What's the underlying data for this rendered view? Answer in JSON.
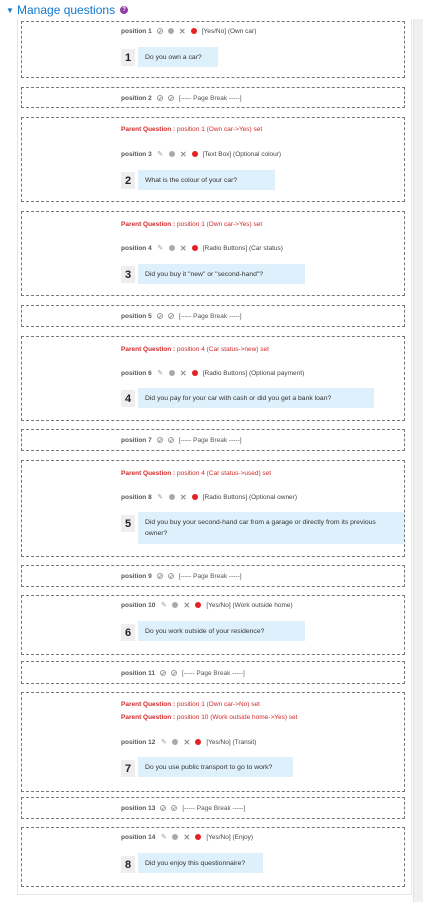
{
  "header": {
    "title": "Manage questions",
    "help_icon": "question-circle-icon",
    "toggle_icon": "caret-down-icon"
  },
  "colors": {
    "link": "#1177d1",
    "parent_text": "#d12a2a",
    "required_dot": "#e52222",
    "question_bg": "#def0fb"
  },
  "parent_prefix": "Parent Question : ",
  "page_break_text": "[----- Page Break -----]",
  "items": [
    {
      "position": "position 1",
      "type": "[Yes/No] (Own car)",
      "number": "1",
      "text": "Do you own a car?"
    },
    {
      "position": "position 2"
    },
    {
      "position": "position 3",
      "parent": "position 1 (Own car->Yes) set",
      "type": "[Text Box] (Optional colour)",
      "number": "2",
      "text": "What is the colour of your car?"
    },
    {
      "position": "position 4",
      "parent": "position 1 (Own car->Yes) set",
      "type": "[Radio Buttons] (Car status)",
      "number": "3",
      "text": "Did you buy it \"new\" or \"second-hand\"?"
    },
    {
      "position": "position 5"
    },
    {
      "position": "position 6",
      "parent": "position 4 (Car status->new) set",
      "type": "[Radio Buttons] (Optional payment)",
      "number": "4",
      "text": "Did you pay for your car with cash or did you get a bank loan?"
    },
    {
      "position": "position 7"
    },
    {
      "position": "position 8",
      "parent": "position 4 (Car status->used) set",
      "type": "[Radio Buttons] (Optional owner)",
      "number": "5",
      "text_line1": "Did you buy your second-hand car from a garage or directly from its previous",
      "text_line2": "owner?"
    },
    {
      "position": "position 9"
    },
    {
      "position": "position 10",
      "type": "[Yes/No] (Work outside home)",
      "number": "6",
      "text": "Do you work outside of your residence?"
    },
    {
      "position": "position 11"
    },
    {
      "position": "position 12",
      "parent": "position 1 (Own car->No) set",
      "parent2": "position 10 (Work outside home->Yes) set",
      "type": "[Yes/No] (Transit)",
      "number": "7",
      "text": "Do you use public transport to go to work?"
    },
    {
      "position": "position 13"
    },
    {
      "position": "position 14",
      "type": "[Yes/No] (Enjoy)",
      "number": "8",
      "text": "Did you enjoy this questionnaire?"
    }
  ]
}
